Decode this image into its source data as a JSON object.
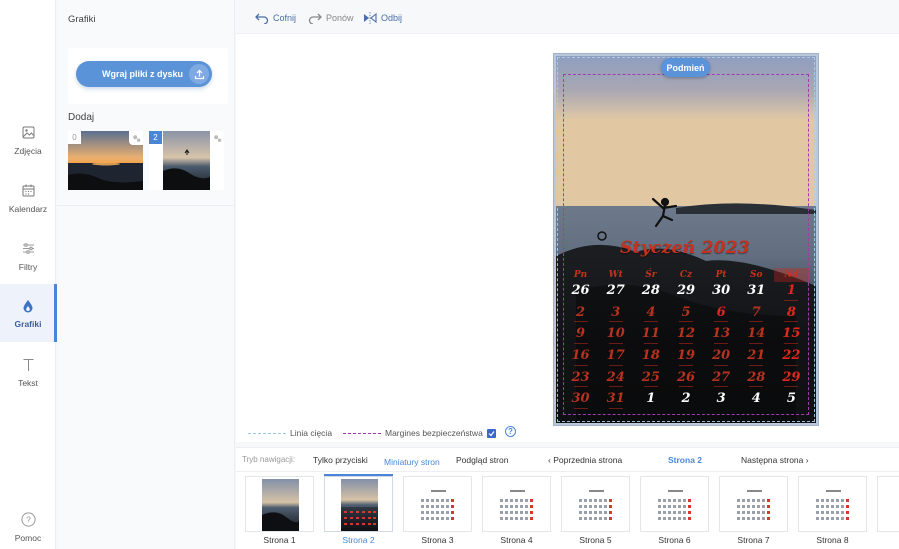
{
  "sidebar": {
    "items": [
      {
        "label": "Zdjęcia",
        "icon": "image-icon"
      },
      {
        "label": "Kalendarz",
        "icon": "calendar-icon"
      },
      {
        "label": "Filtry",
        "icon": "sliders-icon"
      },
      {
        "label": "Grafiki",
        "icon": "drop-icon",
        "active": true
      },
      {
        "label": "Tekst",
        "icon": "text-icon"
      }
    ],
    "help_label": "Pomoc"
  },
  "panel": {
    "title": "Grafiki",
    "upload_label": "Wgraj pliki z dysku",
    "add_label": "Dodaj",
    "thumbs": [
      {
        "count": "0"
      },
      {
        "count": "2"
      }
    ]
  },
  "toolbar": {
    "undo": "Cofnij",
    "redo": "Ponów",
    "flip": "Odbij"
  },
  "canvas": {
    "replace_label": "Podmień",
    "calendar": {
      "title": "Styczeń 2023",
      "weekdays": [
        "Pn",
        "Wt",
        "Śr",
        "Cz",
        "Pt",
        "So",
        "Nd"
      ],
      "weeks": [
        [
          "26",
          "27",
          "28",
          "29",
          "30",
          "31",
          "1"
        ],
        [
          "2",
          "3",
          "4",
          "5",
          "6",
          "7",
          "8"
        ],
        [
          "9",
          "10",
          "11",
          "12",
          "13",
          "14",
          "15"
        ],
        [
          "16",
          "17",
          "18",
          "19",
          "20",
          "21",
          "22"
        ],
        [
          "23",
          "24",
          "25",
          "26",
          "27",
          "28",
          "29"
        ],
        [
          "30",
          "31",
          "1",
          "2",
          "3",
          "4",
          "5"
        ]
      ]
    }
  },
  "legend": {
    "cut_line": "Linia cięcia",
    "safe_margin": "Margines bezpieczeństwa"
  },
  "nav": {
    "mode_label": "Tryb nawigacji:",
    "modes": [
      "Tylko przyciski",
      "Miniatury stron",
      "Podgląd stron"
    ],
    "prev": "‹ Poprzednia strona",
    "current": "Strona 2",
    "next": "Następna strona ›"
  },
  "pages": [
    "Strona 1",
    "Strona 2",
    "Strona 3",
    "Strona 4",
    "Strona 5",
    "Strona 6",
    "Strona 7",
    "Strona 8"
  ],
  "colors": {
    "accent": "#4a86d8",
    "calendar_red": "#c7321e",
    "safe_margin": "#a03cb0"
  }
}
